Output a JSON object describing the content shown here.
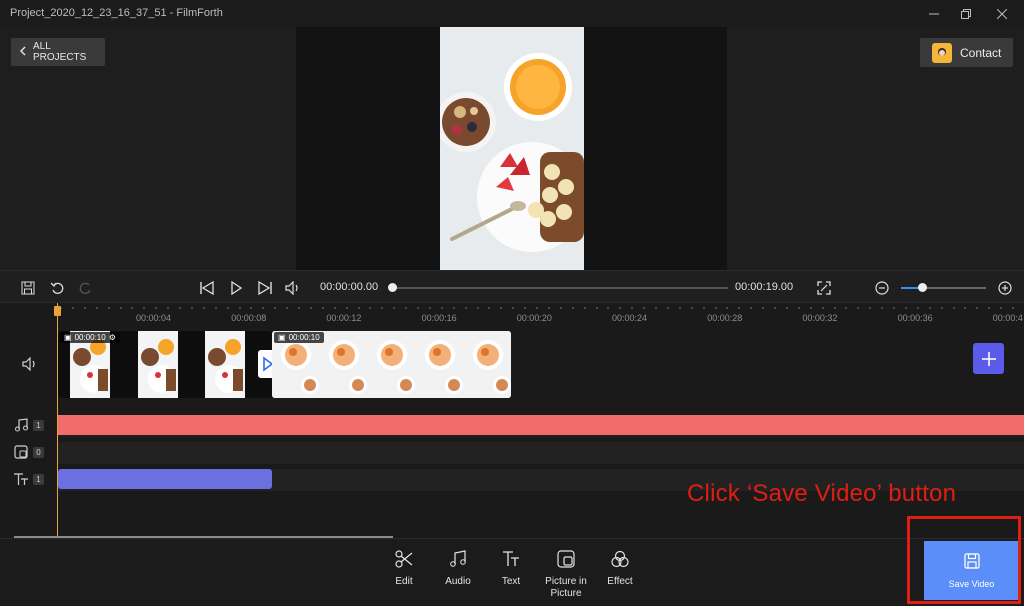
{
  "window": {
    "title": "Project_2020_12_23_16_37_51 - FilmForth",
    "controls": [
      "minimize-icon",
      "restore-icon",
      "close-icon"
    ]
  },
  "header": {
    "back_label": "ALL PROJECTS",
    "contact_label": "Contact"
  },
  "player": {
    "current_time": "00:00:00.00",
    "total_time": "00:00:19.00",
    "progress": 0,
    "zoom_level": 0.25
  },
  "ruler": [
    "00:00:04",
    "00:00:08",
    "00:00:12",
    "00:00:16",
    "00:00:20",
    "00:00:24",
    "00:00:28",
    "00:00:32",
    "00:00:36",
    "00:00:4"
  ],
  "clips": [
    {
      "duration": "00:00:10",
      "kind": "collage"
    },
    {
      "duration": "00:00:10",
      "kind": "food"
    }
  ],
  "tracks": {
    "audio_count": "1",
    "pip_count": "0",
    "text_count": "1"
  },
  "tools": [
    {
      "label": "Edit",
      "icon": "scissors-icon"
    },
    {
      "label": "Audio",
      "icon": "music-icon"
    },
    {
      "label": "Text",
      "icon": "text-icon"
    },
    {
      "label": "Picture in Picture",
      "icon": "pip-icon"
    },
    {
      "label": "Effect",
      "icon": "effect-icon"
    }
  ],
  "save_label": "Save Video",
  "annotation": "Click ‘Save Video’  button",
  "colors": {
    "accent": "#5b8ef8",
    "audio_track": "#f26c6c",
    "text_track": "#6b6fe0",
    "annotation": "#e11e12",
    "playhead": "#e8a43a"
  }
}
